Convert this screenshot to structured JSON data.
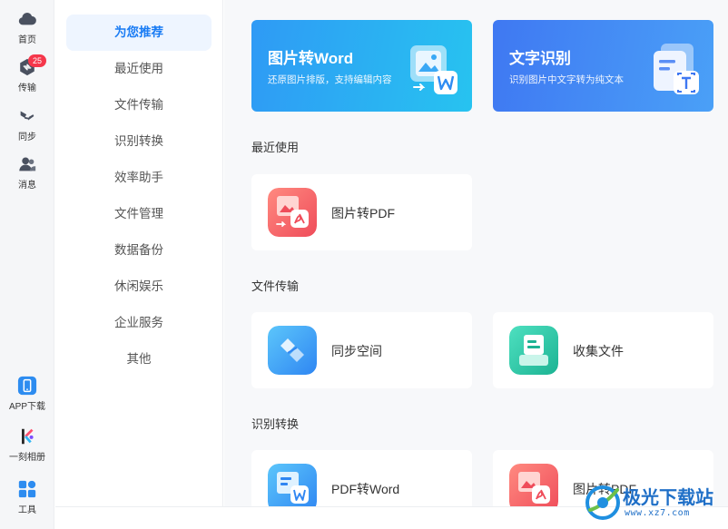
{
  "rail": {
    "home_label": "首页",
    "transfer_label": "传输",
    "transfer_badge": "25",
    "sync_label": "同步",
    "messages_label": "消息",
    "app_download_label": "APP下载",
    "album_label": "一刻相册",
    "tools_label": "工具"
  },
  "categories": [
    "为您推荐",
    "最近使用",
    "文件传输",
    "识别转换",
    "效率助手",
    "文件管理",
    "数据备份",
    "休闲娱乐",
    "企业服务",
    "其他"
  ],
  "banners": [
    {
      "title": "图片转Word",
      "subtitle": "还原图片排版，支持编辑内容"
    },
    {
      "title": "文字识别",
      "subtitle": "识别图片中文字转为纯文本"
    }
  ],
  "sections": {
    "recent": {
      "title": "最近使用",
      "items": [
        "图片转PDF"
      ]
    },
    "transfer": {
      "title": "文件传输",
      "items": [
        "同步空间",
        "收集文件"
      ]
    },
    "convert": {
      "title": "识别转换",
      "items": [
        "PDF转Word",
        "图片转PDF"
      ]
    }
  },
  "watermark": {
    "text": "极光下载站",
    "url": "www.xz7.com"
  },
  "colors": {
    "accent": "#1a7cf4",
    "badge": "#f5374b"
  }
}
